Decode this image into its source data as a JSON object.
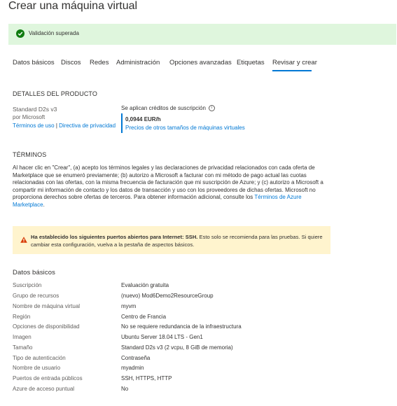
{
  "page": {
    "title": "Crear una máquina virtual"
  },
  "validation": {
    "text": "Validación superada"
  },
  "tabs": [
    {
      "label": "Datos básicos"
    },
    {
      "label": "Discos"
    },
    {
      "label": "Redes"
    },
    {
      "label": "Administración"
    },
    {
      "label": "Opciones avanzadas"
    },
    {
      "label": "Etiquetas"
    },
    {
      "label": "Revisar y crear"
    }
  ],
  "product": {
    "heading": "DETALLES DEL PRODUCTO",
    "name": "Standard D2s v3",
    "publisher": "por Microsoft",
    "terms_link": "Términos de uso",
    "separator": "|",
    "privacy_link": "Directiva de privacidad",
    "credits_text": "Se aplican créditos de suscripción",
    "price": "0,0944 EUR/h",
    "other_prices_link": "Precios de otros tamaños de máquinas virtuales"
  },
  "terms": {
    "heading": "TÉRMINOS",
    "body": "Al hacer clic en \"Crear\", (a) acepto los términos legales y las declaraciones de privacidad relacionados con cada oferta de Marketplace que se enumeró previamente; (b) autorizo a Microsoft a facturar con mi método de pago actual las cuotas relacionadas con las ofertas, con la misma frecuencia de facturación que mi suscripción de Azure; y (c) autorizo a Microsoft a compartir mi información de contacto y los datos de transacción y uso con los proveedores de dichas ofertas. Microsoft no proporciona derechos sobre ofertas de terceros. Para obtener información adicional, consulte los ",
    "link": "Términos de Azure Marketplace",
    "end": "."
  },
  "warning": {
    "bold": "Ha establecido los siguientes puertos abiertos para Internet: SSH.",
    "text": " Esto solo se recomienda para las pruebas.  Si quiere cambiar esta configuración, vuelva a la pestaña de aspectos básicos."
  },
  "basics": {
    "heading": "Datos básicos",
    "rows": [
      {
        "label": "Suscripción",
        "value": "Evaluación gratuita"
      },
      {
        "label": "Grupo de recursos",
        "value": "(nuevo) Mod6Demo2ResourceGroup"
      },
      {
        "label": "Nombre de máquina virtual",
        "value": "myvm"
      },
      {
        "label": "Región",
        "value": "Centro de Francia"
      },
      {
        "label": "Opciones de disponibilidad",
        "value": "No se requiere redundancia de la infraestructura"
      },
      {
        "label": "Imagen",
        "value": "Ubuntu Server 18.04 LTS - Gen1"
      },
      {
        "label": "Tamaño",
        "value": "Standard D2s v3 (2 vcpu, 8 GiB de memoria)"
      },
      {
        "label": "Tipo de autenticación",
        "value": "Contraseña"
      },
      {
        "label": "Nombre de usuario",
        "value": "myadmin"
      },
      {
        "label": "Puertos de entrada públicos",
        "value": "SSH, HTTPS, HTTP"
      },
      {
        "label": "Azure de acceso puntual",
        "value": "No"
      }
    ]
  },
  "colors": {
    "accent": "#0078d4",
    "success_bg": "#dff6dd",
    "success": "#107c10",
    "warning_bg": "#fff4ce",
    "warning": "#d83b01"
  }
}
